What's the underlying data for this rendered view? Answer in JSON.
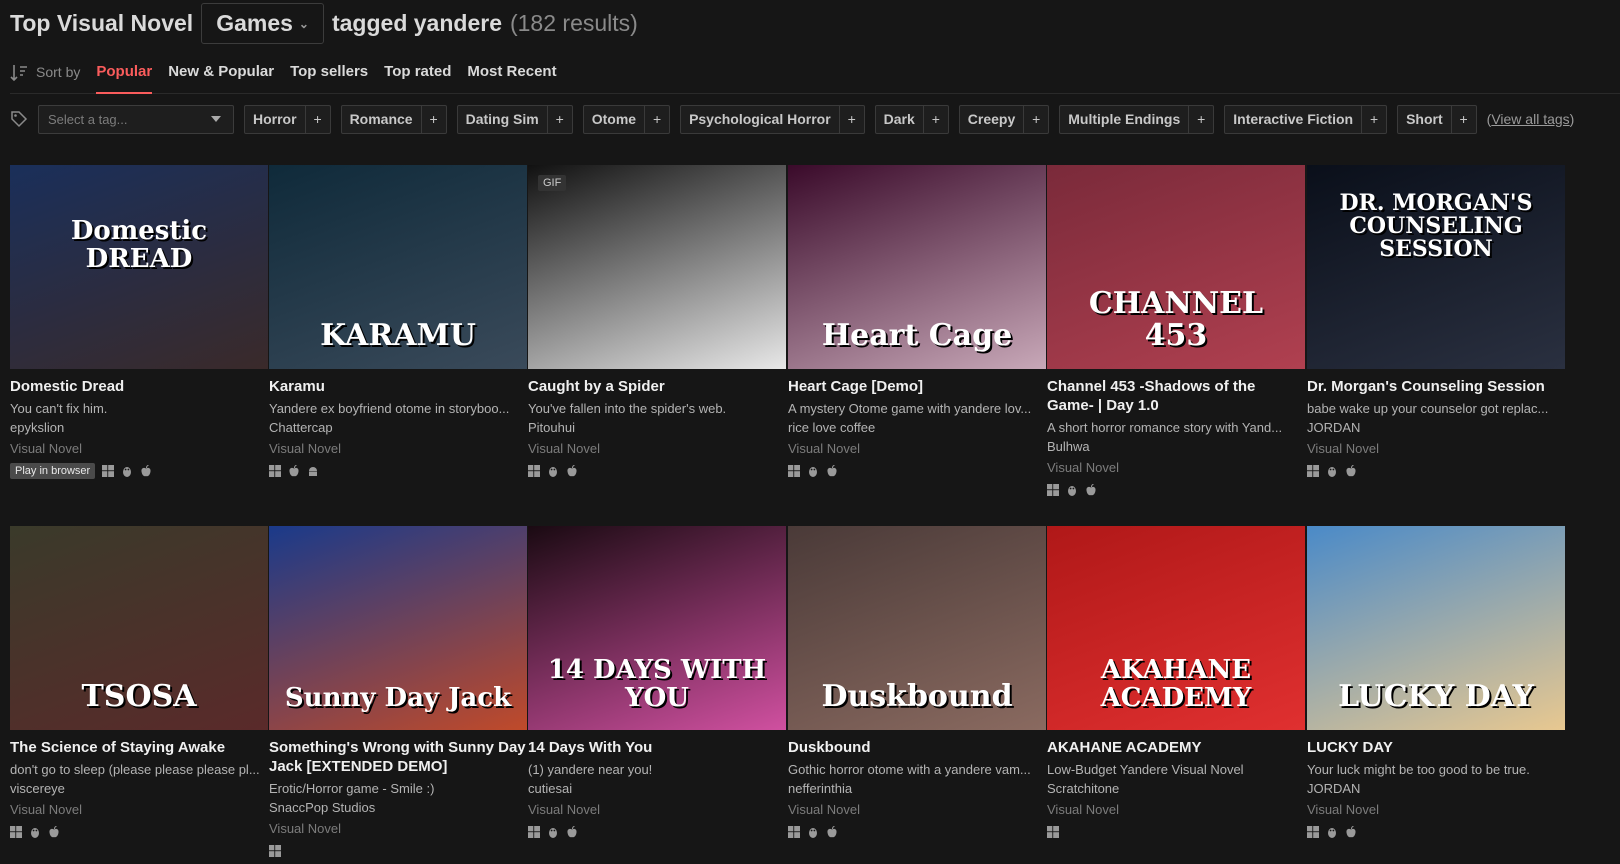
{
  "header": {
    "title": "Top Visual Novel",
    "dropdown": "Games",
    "tagged": "tagged yandere",
    "results": "(182 results)"
  },
  "sort": {
    "label": "Sort by",
    "tabs": [
      "Popular",
      "New & Popular",
      "Top sellers",
      "Top rated",
      "Most Recent"
    ],
    "active": "Popular"
  },
  "tags": {
    "placeholder": "Select a tag...",
    "items": [
      "Horror",
      "Romance",
      "Dating Sim",
      "Otome",
      "Psychological Horror",
      "Dark",
      "Creepy",
      "Multiple Endings",
      "Interactive Fiction",
      "Short"
    ],
    "add": "+",
    "view_all": "View all tags",
    "view_open": "(",
    "view_close": ")"
  },
  "games": [
    {
      "title": "Domestic Dread",
      "desc": "You can't fix him.",
      "author": "epykslion",
      "genre": "Visual Novel",
      "browser": "Play in browser",
      "thumb_text": "Domestic DREAD",
      "colors": [
        "#1a2f5a",
        "#3a2a2a"
      ]
    },
    {
      "title": "Karamu",
      "desc": "Yandere ex boyfriend otome in storyboo...",
      "author": "Chattercap",
      "genre": "Visual Novel",
      "thumb_text": "KARAMU",
      "colors": [
        "#0f2a3a",
        "#3a4a5a"
      ]
    },
    {
      "title": "Caught by a Spider",
      "desc": "You've fallen into the spider's web.",
      "author": "Pitouhui",
      "genre": "Visual Novel",
      "badge": "GIF",
      "thumb_text": "",
      "colors": [
        "#111111",
        "#e8e8e8"
      ]
    },
    {
      "title": "Heart Cage [Demo]",
      "desc": "A mystery Otome game with yandere lov...",
      "author": "rice love coffee",
      "genre": "Visual Novel",
      "thumb_text": "Heart Cage",
      "colors": [
        "#3a0a2a",
        "#c8a8b8"
      ]
    },
    {
      "title": "Channel 453 -Shadows of the Game- | Day 1.0",
      "desc": "A short horror romance story with Yand...",
      "author": "Bulhwa",
      "genre": "Visual Novel",
      "thumb_text": "CHANNEL 453",
      "colors": [
        "#7a2a3a",
        "#b04050"
      ]
    },
    {
      "title": "Dr. Morgan's Counseling Session",
      "desc": "babe wake up your counselor got replac...",
      "author": "JORDAN",
      "genre": "Visual Novel",
      "thumb_text": "DR. MORGAN'S COUNSELING SESSION",
      "colors": [
        "#0a0f1a",
        "#2a3040"
      ]
    },
    {
      "title": "The Science of Staying Awake",
      "desc": "don't go to sleep (please please please pl...",
      "author": "viscereye",
      "genre": "Visual Novel",
      "thumb_text": "TSOSA",
      "colors": [
        "#3a3a2a",
        "#5a2a2a"
      ]
    },
    {
      "title": "Something's Wrong with Sunny Day Jack [EXTENDED DEMO]",
      "desc": "Erotic/Horror game - Smile :)",
      "author": "SnaccPop Studios",
      "genre": "Visual Novel",
      "thumb_text": "Sunny Day Jack",
      "colors": [
        "#1a3a8a",
        "#c04a2a"
      ]
    },
    {
      "title": "14 Days With You",
      "desc": "(1) yandere near you!",
      "author": "cutiesai",
      "genre": "Visual Novel",
      "thumb_text": "14 DAYS WITH YOU",
      "colors": [
        "#1a0a12",
        "#d050a0"
      ]
    },
    {
      "title": "Duskbound",
      "desc": "Gothic horror otome with a yandere vam...",
      "author": "nefferinthia",
      "genre": "Visual Novel",
      "thumb_text": "Duskbound",
      "colors": [
        "#4a3a38",
        "#8a6a60"
      ]
    },
    {
      "title": "AKAHANE ACADEMY",
      "desc": "Low-Budget Yandere Visual Novel",
      "author": "Scratchitone",
      "genre": "Visual Novel",
      "thumb_text": "AKAHANE ACADEMY",
      "colors": [
        "#b01818",
        "#e03030"
      ]
    },
    {
      "title": "LUCKY DAY",
      "desc": "Your luck might be too good to be true.",
      "author": "JORDAN",
      "genre": "Visual Novel",
      "thumb_text": "LUCKY DAY",
      "colors": [
        "#4a8ac8",
        "#e8c890"
      ]
    }
  ]
}
